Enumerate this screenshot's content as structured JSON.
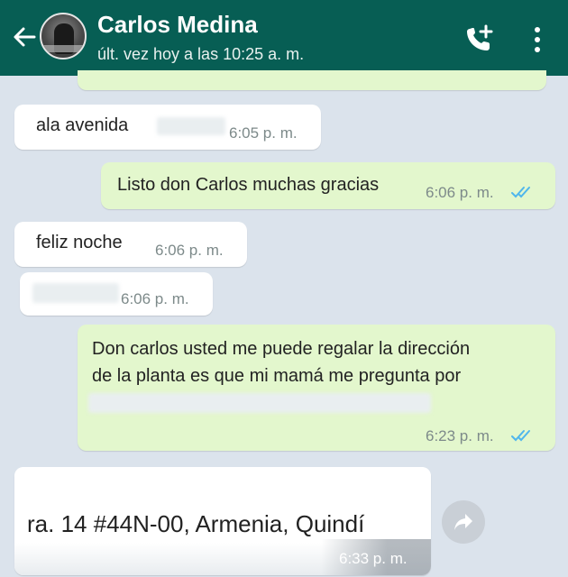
{
  "header": {
    "contact_name": "Carlos Medina",
    "last_seen": "últ. vez hoy a las 10:25 a. m.",
    "icons": [
      "back-arrow-icon",
      "add-call-icon",
      "more-vertical-icon"
    ],
    "color": "#075e54"
  },
  "messages": [
    {
      "direction": "in",
      "text": "ala avenida",
      "time": "6:05 p. m."
    },
    {
      "direction": "out",
      "text": "Listo don Carlos muchas gracias",
      "time": "6:06 p. m.",
      "status": "read"
    },
    {
      "direction": "in",
      "text": "feliz noche",
      "time": "6:06 p. m."
    },
    {
      "direction": "in",
      "text": "",
      "time": "6:06 p. m."
    },
    {
      "direction": "out",
      "line1": "Don carlos usted me puede regalar la dirección",
      "line2": "de la planta es que mi mamá me pregunta por",
      "time": "6:23 p. m.",
      "status": "read"
    },
    {
      "direction": "in",
      "text": "ra. 14 #44N-00, Armenia, Quindí",
      "time": "6:33 p. m."
    }
  ],
  "colors": {
    "outgoing": "#e3f7cd",
    "incoming": "#ffffff",
    "read_ticks": "#4fb6ec",
    "background": "#dbe3ec"
  }
}
